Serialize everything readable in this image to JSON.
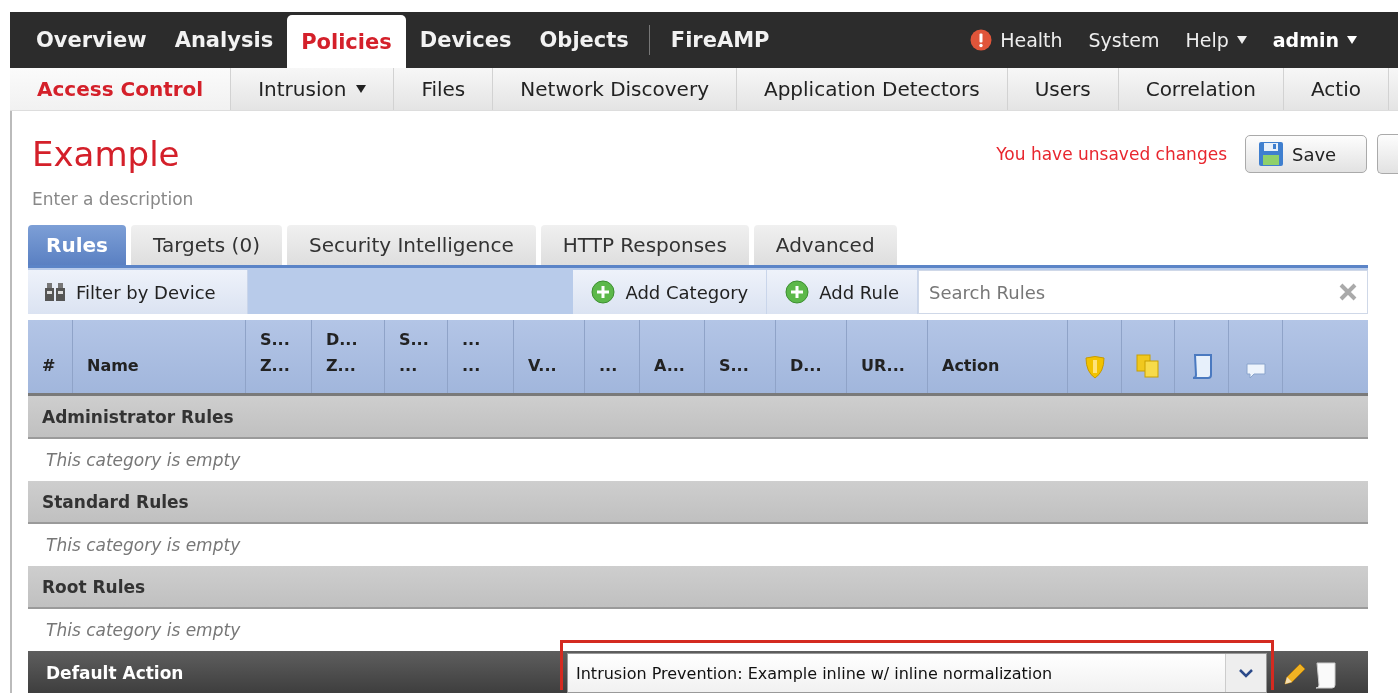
{
  "top_nav": {
    "items": [
      {
        "label": "Overview",
        "selected": false,
        "divider_before": false
      },
      {
        "label": "Analysis",
        "selected": false,
        "divider_before": false
      },
      {
        "label": "Policies",
        "selected": true,
        "divider_before": false
      },
      {
        "label": "Devices",
        "selected": false,
        "divider_before": false
      },
      {
        "label": "Objects",
        "selected": false,
        "divider_before": false
      },
      {
        "label": "FireAMP",
        "selected": false,
        "divider_before": true
      }
    ],
    "right_items": [
      {
        "label": "Health",
        "kind": "status"
      },
      {
        "label": "System",
        "kind": "link"
      },
      {
        "label": "Help",
        "kind": "menu"
      },
      {
        "label": "admin",
        "kind": "user"
      }
    ]
  },
  "sub_nav": [
    {
      "label": "Access Control",
      "selected": true,
      "menu": false
    },
    {
      "label": "Intrusion",
      "selected": false,
      "menu": true
    },
    {
      "label": "Files",
      "selected": false,
      "menu": false
    },
    {
      "label": "Network Discovery",
      "selected": false,
      "menu": false
    },
    {
      "label": "Application Detectors",
      "selected": false,
      "menu": false
    },
    {
      "label": "Users",
      "selected": false,
      "menu": false
    },
    {
      "label": "Correlation",
      "selected": false,
      "menu": false
    },
    {
      "label": "Actio",
      "selected": false,
      "menu": false
    }
  ],
  "policy": {
    "title": "Example",
    "description_placeholder": "Enter a description",
    "unsaved_message": "You have unsaved changes",
    "save_button": "Save"
  },
  "tabs": [
    {
      "label": "Rules",
      "selected": true
    },
    {
      "label": "Targets (0)",
      "selected": false
    },
    {
      "label": "Security Intelligence",
      "selected": false
    },
    {
      "label": "HTTP Responses",
      "selected": false
    },
    {
      "label": "Advanced",
      "selected": false
    }
  ],
  "toolbar": {
    "filter_button": "Filter by Device",
    "add_category_button": "Add Category",
    "add_rule_button": "Add Rule",
    "search": {
      "placeholder": "Search Rules"
    }
  },
  "table": {
    "columns": [
      "#",
      "Name",
      "S...\nZ...",
      "D...\nZ...",
      "S...\n...",
      "...\n...",
      "V...",
      "...",
      "A...",
      "S...",
      "D...",
      "UR...",
      "Action"
    ],
    "categories": [
      {
        "name": "Administrator Rules",
        "empty_text": "This category is empty"
      },
      {
        "name": "Standard Rules",
        "empty_text": "This category is empty"
      },
      {
        "name": "Root Rules",
        "empty_text": "This category is empty"
      }
    ]
  },
  "default_action": {
    "label": "Default Action",
    "value": "Intrusion Prevention: Example inline w/ inline normalization",
    "highlighted": true
  }
}
